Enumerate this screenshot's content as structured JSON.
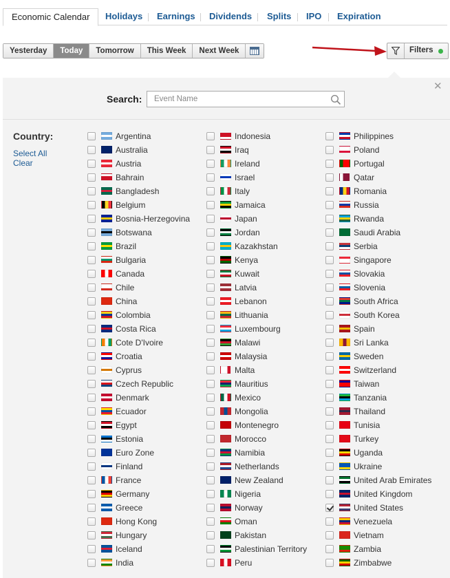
{
  "tabs": [
    {
      "label": "Economic Calendar",
      "active": true
    },
    {
      "label": "Holidays"
    },
    {
      "label": "Earnings"
    },
    {
      "label": "Dividends"
    },
    {
      "label": "Splits"
    },
    {
      "label": "IPO"
    },
    {
      "label": "Expiration"
    }
  ],
  "day_buttons": [
    {
      "label": "Yesterday"
    },
    {
      "label": "Today",
      "active": true
    },
    {
      "label": "Tomorrow"
    },
    {
      "label": "This Week"
    },
    {
      "label": "Next Week"
    }
  ],
  "filters": {
    "label": "Filters",
    "status_color": "#3bb44a"
  },
  "annotation_arrow_color": "#c0141b",
  "search": {
    "label": "Search:",
    "placeholder": "Event Name",
    "value": ""
  },
  "country": {
    "label": "Country:",
    "select_all": "Select All",
    "clear": "Clear"
  },
  "countries": [
    {
      "name": "Argentina",
      "checked": false,
      "flag": [
        "#74acdf",
        "#ffffff",
        "#74acdf"
      ]
    },
    {
      "name": "Australia",
      "checked": false,
      "flag": [
        "#012169",
        "#012169",
        "#012169"
      ]
    },
    {
      "name": "Austria",
      "checked": false,
      "flag": [
        "#ed2939",
        "#ffffff",
        "#ed2939"
      ]
    },
    {
      "name": "Bahrain",
      "checked": false,
      "flag": [
        "#ffffff",
        "#ce1126",
        "#ce1126"
      ]
    },
    {
      "name": "Bangladesh",
      "checked": false,
      "flag": [
        "#006a4e",
        "#d0223c",
        "#006a4e"
      ]
    },
    {
      "name": "Belgium",
      "checked": false,
      "flag": [
        "#000000",
        "#fdda24",
        "#ef3340"
      ],
      "vertical": true
    },
    {
      "name": "Bosnia-Herzegovina",
      "checked": false,
      "flag": [
        "#002395",
        "#fecb00",
        "#002395"
      ]
    },
    {
      "name": "Botswana",
      "checked": false,
      "flag": [
        "#75aadb",
        "#000000",
        "#75aadb"
      ]
    },
    {
      "name": "Brazil",
      "checked": false,
      "flag": [
        "#009c3b",
        "#ffdf00",
        "#009c3b"
      ]
    },
    {
      "name": "Bulgaria",
      "checked": false,
      "flag": [
        "#ffffff",
        "#00966e",
        "#d62612"
      ]
    },
    {
      "name": "Canada",
      "checked": false,
      "flag": [
        "#ff0000",
        "#ffffff",
        "#ff0000"
      ],
      "vertical": true
    },
    {
      "name": "Chile",
      "checked": false,
      "flag": [
        "#ffffff",
        "#ffffff",
        "#d52b1e"
      ]
    },
    {
      "name": "China",
      "checked": false,
      "flag": [
        "#de2910",
        "#de2910",
        "#de2910"
      ]
    },
    {
      "name": "Colombia",
      "checked": false,
      "flag": [
        "#fcd116",
        "#003893",
        "#ce1126"
      ]
    },
    {
      "name": "Costa Rica",
      "checked": false,
      "flag": [
        "#002b7f",
        "#ce1126",
        "#002b7f"
      ]
    },
    {
      "name": "Cote D'Ivoire",
      "checked": false,
      "flag": [
        "#f77f00",
        "#ffffff",
        "#009e60"
      ],
      "vertical": true
    },
    {
      "name": "Croatia",
      "checked": false,
      "flag": [
        "#ff0000",
        "#ffffff",
        "#171796"
      ]
    },
    {
      "name": "Cyprus",
      "checked": false,
      "flag": [
        "#ffffff",
        "#d57800",
        "#ffffff"
      ]
    },
    {
      "name": "Czech Republic",
      "checked": false,
      "flag": [
        "#ffffff",
        "#d7141a",
        "#11457e"
      ]
    },
    {
      "name": "Denmark",
      "checked": false,
      "flag": [
        "#c60c30",
        "#ffffff",
        "#c60c30"
      ]
    },
    {
      "name": "Ecuador",
      "checked": false,
      "flag": [
        "#ffdd00",
        "#034ea2",
        "#ed1c24"
      ]
    },
    {
      "name": "Egypt",
      "checked": false,
      "flag": [
        "#ce1126",
        "#ffffff",
        "#000000"
      ]
    },
    {
      "name": "Estonia",
      "checked": false,
      "flag": [
        "#0072ce",
        "#000000",
        "#ffffff"
      ]
    },
    {
      "name": "Euro Zone",
      "checked": false,
      "flag": [
        "#003399",
        "#003399",
        "#003399"
      ]
    },
    {
      "name": "Finland",
      "checked": false,
      "flag": [
        "#ffffff",
        "#003580",
        "#ffffff"
      ]
    },
    {
      "name": "France",
      "checked": false,
      "flag": [
        "#0055a4",
        "#ffffff",
        "#ef4135"
      ],
      "vertical": true
    },
    {
      "name": "Germany",
      "checked": false,
      "flag": [
        "#000000",
        "#dd0000",
        "#ffce00"
      ]
    },
    {
      "name": "Greece",
      "checked": false,
      "flag": [
        "#0d5eaf",
        "#ffffff",
        "#0d5eaf"
      ]
    },
    {
      "name": "Hong Kong",
      "checked": false,
      "flag": [
        "#de2910",
        "#de2910",
        "#de2910"
      ]
    },
    {
      "name": "Hungary",
      "checked": false,
      "flag": [
        "#ce2939",
        "#ffffff",
        "#477050"
      ]
    },
    {
      "name": "Iceland",
      "checked": false,
      "flag": [
        "#02529c",
        "#dc1e35",
        "#02529c"
      ]
    },
    {
      "name": "India",
      "checked": false,
      "flag": [
        "#ff9933",
        "#ffffff",
        "#138808"
      ]
    },
    {
      "name": "Indonesia",
      "checked": false,
      "flag": [
        "#ce1126",
        "#ce1126",
        "#ffffff"
      ]
    },
    {
      "name": "Iraq",
      "checked": false,
      "flag": [
        "#ce1126",
        "#ffffff",
        "#000000"
      ]
    },
    {
      "name": "Ireland",
      "checked": false,
      "flag": [
        "#169b62",
        "#ffffff",
        "#ff883e"
      ],
      "vertical": true
    },
    {
      "name": "Israel",
      "checked": false,
      "flag": [
        "#ffffff",
        "#0038b8",
        "#ffffff"
      ]
    },
    {
      "name": "Italy",
      "checked": false,
      "flag": [
        "#009246",
        "#ffffff",
        "#ce2b37"
      ],
      "vertical": true
    },
    {
      "name": "Jamaica",
      "checked": false,
      "flag": [
        "#009b3a",
        "#fed100",
        "#000000"
      ]
    },
    {
      "name": "Japan",
      "checked": false,
      "flag": [
        "#ffffff",
        "#bc002d",
        "#ffffff"
      ]
    },
    {
      "name": "Jordan",
      "checked": false,
      "flag": [
        "#000000",
        "#ffffff",
        "#007a3d"
      ]
    },
    {
      "name": "Kazakhstan",
      "checked": false,
      "flag": [
        "#00afca",
        "#fec50c",
        "#00afca"
      ]
    },
    {
      "name": "Kenya",
      "checked": false,
      "flag": [
        "#000000",
        "#bb0000",
        "#006600"
      ]
    },
    {
      "name": "Kuwait",
      "checked": false,
      "flag": [
        "#007a3d",
        "#ffffff",
        "#ce1126"
      ]
    },
    {
      "name": "Latvia",
      "checked": false,
      "flag": [
        "#9e3039",
        "#ffffff",
        "#9e3039"
      ]
    },
    {
      "name": "Lebanon",
      "checked": false,
      "flag": [
        "#ed1c24",
        "#ffffff",
        "#ed1c24"
      ]
    },
    {
      "name": "Lithuania",
      "checked": false,
      "flag": [
        "#fdb913",
        "#006a44",
        "#c1272d"
      ]
    },
    {
      "name": "Luxembourg",
      "checked": false,
      "flag": [
        "#ed2939",
        "#ffffff",
        "#00a1de"
      ]
    },
    {
      "name": "Malawi",
      "checked": false,
      "flag": [
        "#000000",
        "#ce1126",
        "#339e35"
      ]
    },
    {
      "name": "Malaysia",
      "checked": false,
      "flag": [
        "#cc0001",
        "#ffffff",
        "#cc0001"
      ]
    },
    {
      "name": "Malta",
      "checked": false,
      "flag": [
        "#ffffff",
        "#ffffff",
        "#cf142b"
      ],
      "vertical": true
    },
    {
      "name": "Mauritius",
      "checked": false,
      "flag": [
        "#ea2839",
        "#1a206d",
        "#00a551"
      ]
    },
    {
      "name": "Mexico",
      "checked": false,
      "flag": [
        "#006847",
        "#ffffff",
        "#ce1126"
      ],
      "vertical": true
    },
    {
      "name": "Mongolia",
      "checked": false,
      "flag": [
        "#c4272f",
        "#015197",
        "#c4272f"
      ],
      "vertical": true
    },
    {
      "name": "Montenegro",
      "checked": false,
      "flag": [
        "#c40308",
        "#c40308",
        "#c40308"
      ]
    },
    {
      "name": "Morocco",
      "checked": false,
      "flag": [
        "#c1272d",
        "#c1272d",
        "#c1272d"
      ]
    },
    {
      "name": "Namibia",
      "checked": false,
      "flag": [
        "#003580",
        "#d21034",
        "#009543"
      ]
    },
    {
      "name": "Netherlands",
      "checked": false,
      "flag": [
        "#ae1c28",
        "#ffffff",
        "#21468b"
      ]
    },
    {
      "name": "New Zealand",
      "checked": false,
      "flag": [
        "#012169",
        "#012169",
        "#012169"
      ]
    },
    {
      "name": "Nigeria",
      "checked": false,
      "flag": [
        "#008751",
        "#ffffff",
        "#008751"
      ],
      "vertical": true
    },
    {
      "name": "Norway",
      "checked": false,
      "flag": [
        "#ba0c2f",
        "#00205b",
        "#ba0c2f"
      ]
    },
    {
      "name": "Oman",
      "checked": false,
      "flag": [
        "#ffffff",
        "#db161b",
        "#008000"
      ]
    },
    {
      "name": "Pakistan",
      "checked": false,
      "flag": [
        "#01411c",
        "#01411c",
        "#01411c"
      ]
    },
    {
      "name": "Palestinian Territory",
      "checked": false,
      "flag": [
        "#000000",
        "#ffffff",
        "#009736"
      ]
    },
    {
      "name": "Peru",
      "checked": false,
      "flag": [
        "#d91023",
        "#ffffff",
        "#d91023"
      ],
      "vertical": true
    },
    {
      "name": "Philippines",
      "checked": false,
      "flag": [
        "#0038a8",
        "#ffffff",
        "#ce1126"
      ]
    },
    {
      "name": "Poland",
      "checked": false,
      "flag": [
        "#ffffff",
        "#ffffff",
        "#dc143c"
      ]
    },
    {
      "name": "Portugal",
      "checked": false,
      "flag": [
        "#006600",
        "#ff0000",
        "#ff0000"
      ],
      "vertical": true
    },
    {
      "name": "Qatar",
      "checked": false,
      "flag": [
        "#ffffff",
        "#8a1538",
        "#8a1538"
      ],
      "vertical": true
    },
    {
      "name": "Romania",
      "checked": false,
      "flag": [
        "#002b7f",
        "#fcd116",
        "#ce1126"
      ],
      "vertical": true
    },
    {
      "name": "Russia",
      "checked": false,
      "flag": [
        "#ffffff",
        "#0039a6",
        "#d52b1e"
      ]
    },
    {
      "name": "Rwanda",
      "checked": false,
      "flag": [
        "#00a1de",
        "#fad201",
        "#20603d"
      ]
    },
    {
      "name": "Saudi Arabia",
      "checked": false,
      "flag": [
        "#006c35",
        "#006c35",
        "#006c35"
      ]
    },
    {
      "name": "Serbia",
      "checked": false,
      "flag": [
        "#c6363c",
        "#0c4076",
        "#ffffff"
      ]
    },
    {
      "name": "Singapore",
      "checked": false,
      "flag": [
        "#ed2939",
        "#ffffff",
        "#ffffff"
      ]
    },
    {
      "name": "Slovakia",
      "checked": false,
      "flag": [
        "#ffffff",
        "#0b4ea2",
        "#ee1c25"
      ]
    },
    {
      "name": "Slovenia",
      "checked": false,
      "flag": [
        "#ffffff",
        "#005da4",
        "#ed1c24"
      ]
    },
    {
      "name": "South Africa",
      "checked": false,
      "flag": [
        "#e03c31",
        "#007749",
        "#001489"
      ]
    },
    {
      "name": "South Korea",
      "checked": false,
      "flag": [
        "#ffffff",
        "#cd2e3a",
        "#ffffff"
      ]
    },
    {
      "name": "Spain",
      "checked": false,
      "flag": [
        "#aa151b",
        "#f1bf00",
        "#aa151b"
      ]
    },
    {
      "name": "Sri Lanka",
      "checked": false,
      "flag": [
        "#ffb700",
        "#8d153a",
        "#ffb700"
      ],
      "vertical": true
    },
    {
      "name": "Sweden",
      "checked": false,
      "flag": [
        "#006aa7",
        "#fecc00",
        "#006aa7"
      ]
    },
    {
      "name": "Switzerland",
      "checked": false,
      "flag": [
        "#ff0000",
        "#ffffff",
        "#ff0000"
      ]
    },
    {
      "name": "Taiwan",
      "checked": false,
      "flag": [
        "#000095",
        "#fe0000",
        "#fe0000"
      ]
    },
    {
      "name": "Tanzania",
      "checked": false,
      "flag": [
        "#1eb53a",
        "#000000",
        "#00a3dd"
      ]
    },
    {
      "name": "Thailand",
      "checked": false,
      "flag": [
        "#a51931",
        "#2d2a4a",
        "#a51931"
      ]
    },
    {
      "name": "Tunisia",
      "checked": false,
      "flag": [
        "#e70013",
        "#e70013",
        "#e70013"
      ]
    },
    {
      "name": "Turkey",
      "checked": false,
      "flag": [
        "#e30a17",
        "#e30a17",
        "#e30a17"
      ]
    },
    {
      "name": "Uganda",
      "checked": false,
      "flag": [
        "#000000",
        "#fcdc04",
        "#d90000"
      ]
    },
    {
      "name": "Ukraine",
      "checked": false,
      "flag": [
        "#0057b7",
        "#0057b7",
        "#ffd700"
      ]
    },
    {
      "name": "United Arab Emirates",
      "checked": false,
      "flag": [
        "#00732f",
        "#ffffff",
        "#000000"
      ]
    },
    {
      "name": "United Kingdom",
      "checked": false,
      "flag": [
        "#012169",
        "#c8102e",
        "#012169"
      ]
    },
    {
      "name": "United States",
      "checked": true,
      "flag": [
        "#b22234",
        "#ffffff",
        "#3c3b6e"
      ]
    },
    {
      "name": "Venezuela",
      "checked": false,
      "flag": [
        "#ffcc00",
        "#00247d",
        "#cf142b"
      ]
    },
    {
      "name": "Vietnam",
      "checked": false,
      "flag": [
        "#da251d",
        "#da251d",
        "#da251d"
      ]
    },
    {
      "name": "Zambia",
      "checked": false,
      "flag": [
        "#198a00",
        "#198a00",
        "#de2010"
      ]
    },
    {
      "name": "Zimbabwe",
      "checked": false,
      "flag": [
        "#006400",
        "#ffd200",
        "#d40000"
      ]
    }
  ]
}
